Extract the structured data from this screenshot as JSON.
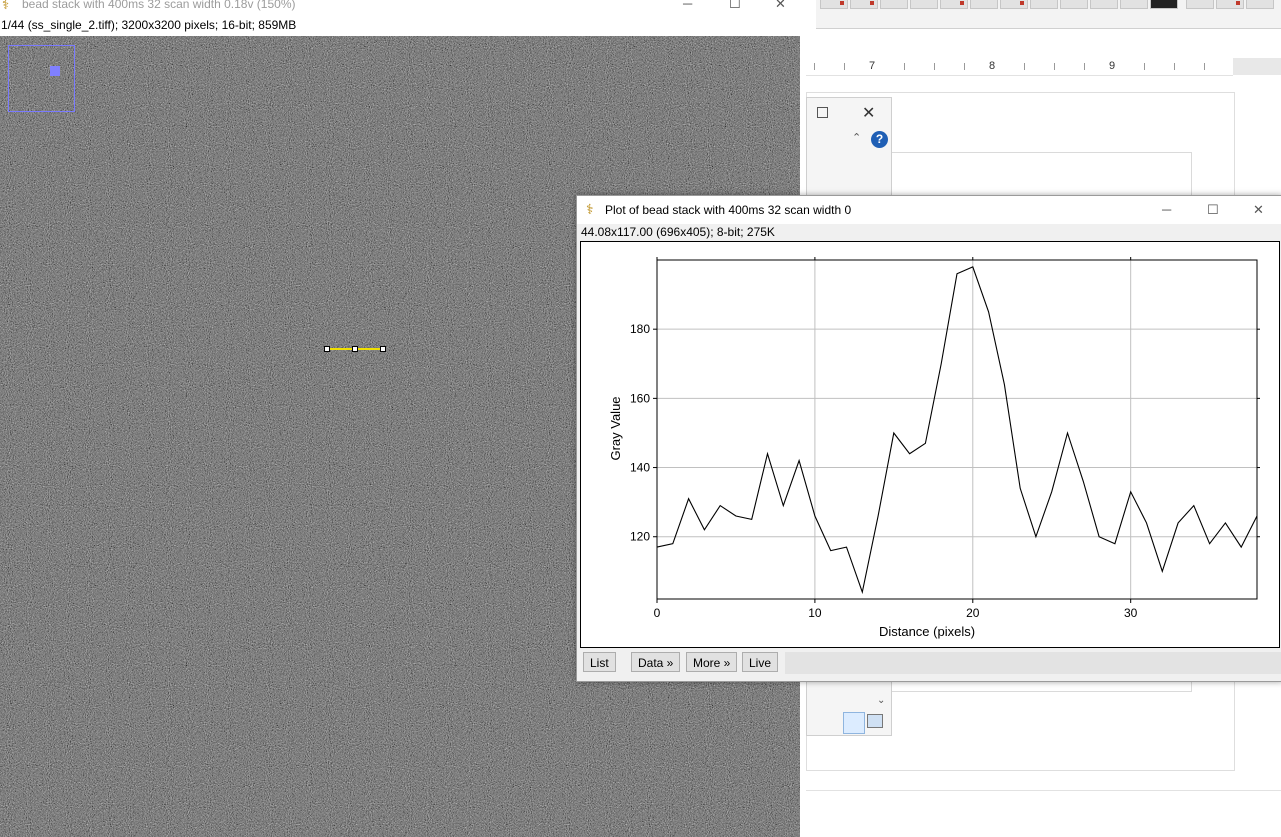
{
  "image_window": {
    "title": "bead stack with 400ms 32 scan width 0.18v (150%)",
    "info": "1/44 (ss_single_2.tiff); 3200x3200 pixels; 16-bit; 859MB"
  },
  "window_controls": {
    "minimize": "─",
    "maximize": "☐",
    "close": "✕"
  },
  "plot_window": {
    "title": "Plot of bead stack with 400ms 32 scan width 0",
    "info": "44.08x117.00   (696x405); 8-bit; 275K",
    "buttons": {
      "list": "List",
      "data": "Data »",
      "more": "More »",
      "live": "Live"
    }
  },
  "background_app": {
    "ruler_numbers": [
      "7",
      "8",
      "9"
    ],
    "help_label": "?"
  },
  "colors": {
    "image_background": "#5c5c5c",
    "selection_line": "#f0e000",
    "navigator": "#8080ff",
    "plot_line": "#000000",
    "grid": "#c0c0c0"
  },
  "chart_data": {
    "type": "line",
    "title": "",
    "xlabel": "Distance (pixels)",
    "ylabel": "Gray Value",
    "xlim": [
      0,
      38
    ],
    "ylim": [
      102,
      200
    ],
    "xticks": [
      0,
      10,
      20,
      30
    ],
    "yticks": [
      120,
      140,
      160,
      180
    ],
    "grid": true,
    "series": [
      {
        "x": [
          0,
          1,
          2,
          3,
          4,
          5,
          6,
          7,
          8,
          9,
          10,
          11,
          12,
          13,
          14,
          15,
          16,
          17,
          18,
          19,
          20,
          21,
          22,
          23,
          24,
          25,
          26,
          27,
          28,
          29,
          30,
          31,
          32,
          33,
          34,
          35,
          36,
          37,
          38
        ],
        "values": [
          117,
          118,
          131,
          122,
          129,
          126,
          125,
          144,
          129,
          142,
          126,
          116,
          117,
          104,
          126,
          150,
          144,
          147,
          170,
          196,
          198,
          185,
          164,
          134,
          120,
          133,
          150,
          136,
          120,
          118,
          133,
          124,
          110,
          124,
          129,
          118,
          124,
          117,
          126
        ]
      }
    ]
  }
}
